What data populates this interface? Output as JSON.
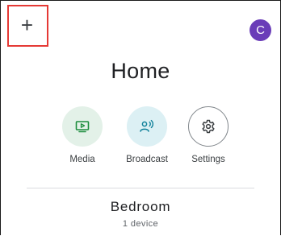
{
  "header": {
    "add_icon": "plus-icon",
    "add_glyph": "+",
    "avatar_initial": "C",
    "avatar_color": "#6a3db8",
    "highlight_color": "#e53935"
  },
  "home": {
    "title": "Home"
  },
  "actions": [
    {
      "label": "Media",
      "icon": "media-icon",
      "color": "#1e8e3e"
    },
    {
      "label": "Broadcast",
      "icon": "broadcast-icon",
      "color": "#12829b"
    },
    {
      "label": "Settings",
      "icon": "gear-icon",
      "color": "#3c4043"
    }
  ],
  "rooms": [
    {
      "name": "Bedroom",
      "device_count": "1 device"
    }
  ]
}
